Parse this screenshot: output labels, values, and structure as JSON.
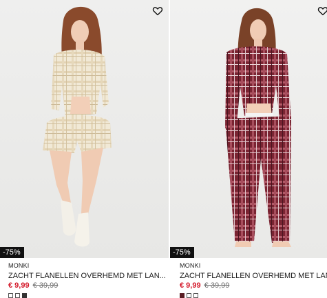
{
  "products": [
    {
      "brand": "MONKI",
      "title": "ZACHT FLANELLEN OVERHEMD MET LAN...",
      "price": "€ 9,99",
      "original_price": "€ 39,99",
      "discount_badge": "-75%",
      "image_alt": "model wearing cream plaid flannel shirt and shorts",
      "swatches": [
        "outline",
        "outline",
        "filled"
      ],
      "wishlist_icon": "heart-outline-icon"
    },
    {
      "brand": "MONKI",
      "title": "ZACHT FLANELLEN OVERHEMD MET LAN...",
      "price": "€ 9,99",
      "original_price": "€ 39,99",
      "discount_badge": "-75%",
      "image_alt": "model wearing burgundy plaid flannel shirt and trousers",
      "swatches": [
        "maroon",
        "outline",
        "outline"
      ],
      "wishlist_icon": "heart-outline-icon"
    }
  ],
  "colors": {
    "sale_price": "#d41a2b",
    "badge_bg": "#111111",
    "cream_plaid": "#eee4cf",
    "burgundy_plaid": "#7a2432"
  }
}
